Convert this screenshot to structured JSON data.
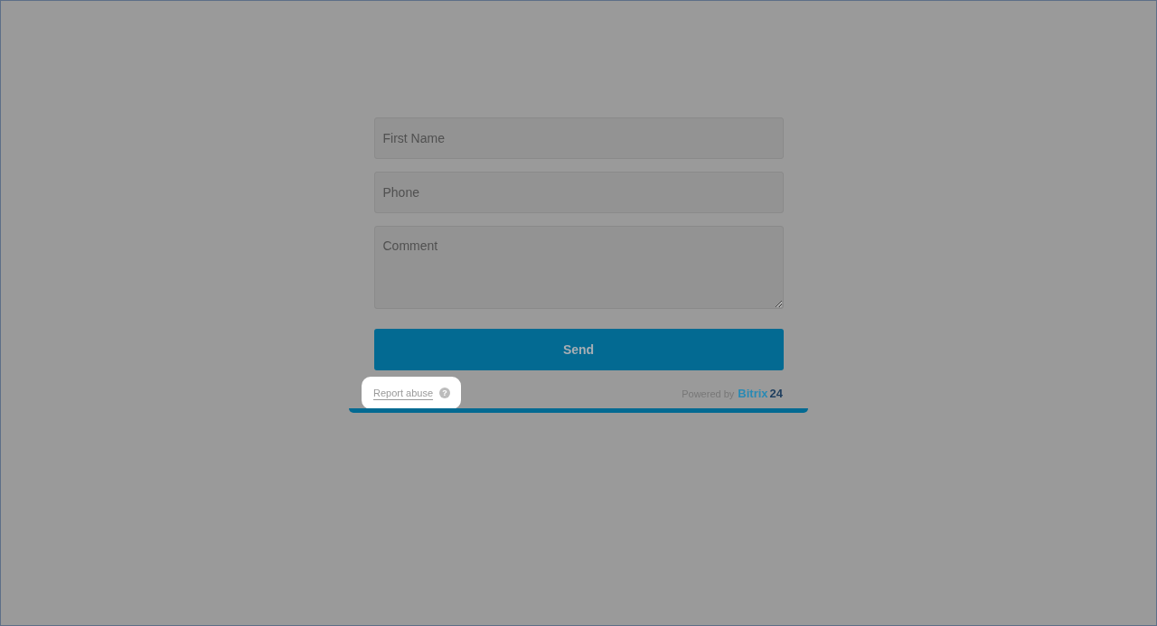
{
  "form": {
    "fields": [
      {
        "kind": "input",
        "placeholder": "First Name"
      },
      {
        "kind": "input",
        "placeholder": "Phone"
      },
      {
        "kind": "textarea",
        "placeholder": "Comment"
      }
    ],
    "submit": "Send"
  },
  "footer": {
    "report_link": "Report abuse",
    "help_icon": "?",
    "powered_by": "Powered by",
    "brand": [
      "Bitrix",
      "24"
    ]
  }
}
